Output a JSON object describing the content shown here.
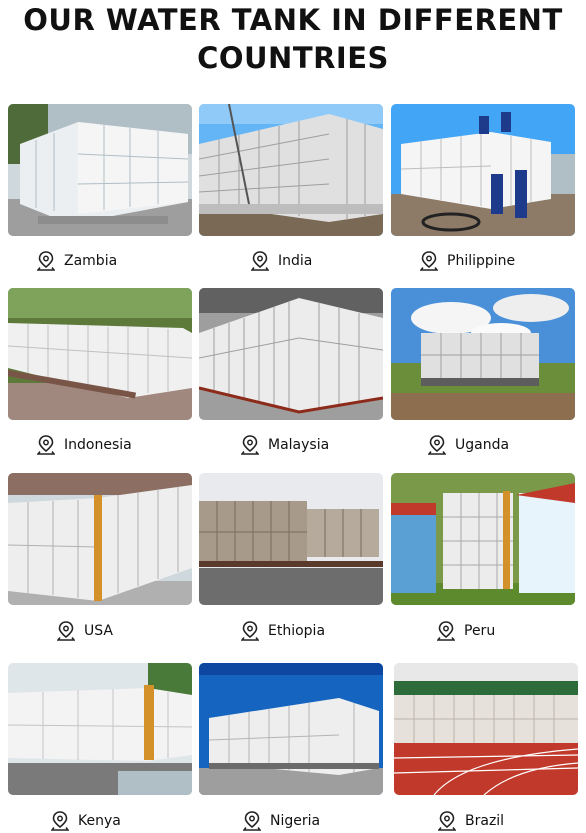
{
  "header": {
    "title_line1": "OUR WATER TANK IN DIFFERENT",
    "title_line2": "COUNTRIES"
  },
  "icons": {
    "location": "location-pin-icon"
  },
  "countries": [
    "Zambia",
    "India",
    "Philippine",
    "Indonesia",
    "Malaysia",
    "Uganda",
    "USA",
    "Ethiopia",
    "Peru",
    "Kenya",
    "Nigeria",
    "Brazil"
  ]
}
